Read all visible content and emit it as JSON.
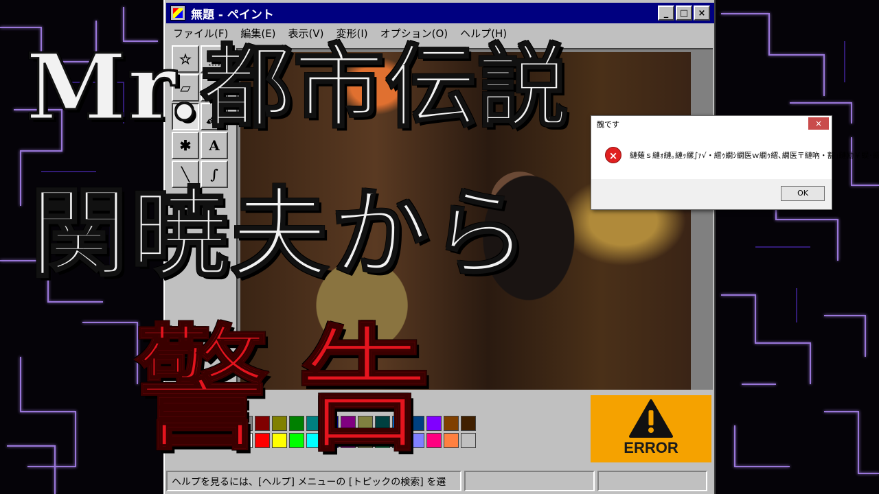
{
  "window": {
    "title": "無題 - ペイント",
    "minimize": "_",
    "maximize": "□",
    "close": "×"
  },
  "menu": [
    {
      "label": "ファイル(F)"
    },
    {
      "label": "編集(E)"
    },
    {
      "label": "表示(V)"
    },
    {
      "label": "変形(I)"
    },
    {
      "label": "オプション(O)"
    },
    {
      "label": "ヘルプ(H)"
    }
  ],
  "tools": [
    {
      "name": "free-select-icon",
      "glyph": "☆"
    },
    {
      "name": "rect-select-icon",
      "glyph": "⬚"
    },
    {
      "name": "eraser-icon",
      "glyph": "▱"
    },
    {
      "name": "fill-icon",
      "glyph": "◐"
    },
    {
      "name": "pencil-icon",
      "glyph": "✎"
    },
    {
      "name": "brush-icon",
      "glyph": "🖌"
    },
    {
      "name": "airbrush-icon",
      "glyph": "✱"
    },
    {
      "name": "text-tool-icon",
      "glyph": "A"
    },
    {
      "name": "line-icon",
      "glyph": "╲"
    },
    {
      "name": "curve-icon",
      "glyph": "∫"
    }
  ],
  "palette": {
    "row1": [
      "#808080",
      "#800000",
      "#808000",
      "#008000",
      "#008080",
      "#000080",
      "#800080",
      "#808040",
      "#004040",
      "#0080ff",
      "#004080",
      "#8000ff",
      "#804000",
      "#402000"
    ],
    "row2": [
      "#ffffff",
      "#ff0000",
      "#ffff00",
      "#00ff00",
      "#00ffff",
      "#0000ff",
      "#ff00ff",
      "#ffff80",
      "#00ff80",
      "#80ffff",
      "#8080ff",
      "#ff0080",
      "#ff8040",
      "#c0c0c0"
    ]
  },
  "status": {
    "help_text": "ヘルプを見るには、[ヘルプ] メニューの [トピックの検索] を選",
    "position": "",
    "size": ""
  },
  "dialog": {
    "title": "醜です",
    "close": "×",
    "message": "縺薙ｓ縺ｫ縺｡縺ｯ縲∫ｧ√・繧ｩ繝ｼ繝医ｗ繝ｩ繧､繝医〒縺吶・豁｣縺励￥蜈･繧・",
    "ok": "OK"
  },
  "error_badge": {
    "label": "ERROR",
    "color": "#f5a200"
  },
  "overlay": {
    "line1": "Mr.都市伝説",
    "line2": "関暁夫から",
    "line3": "警告"
  },
  "colors": {
    "titlebar": "#000080",
    "window_face": "#c0c0c0",
    "warning_red": "#e4141e",
    "circuit_glow": "#a070ff"
  }
}
